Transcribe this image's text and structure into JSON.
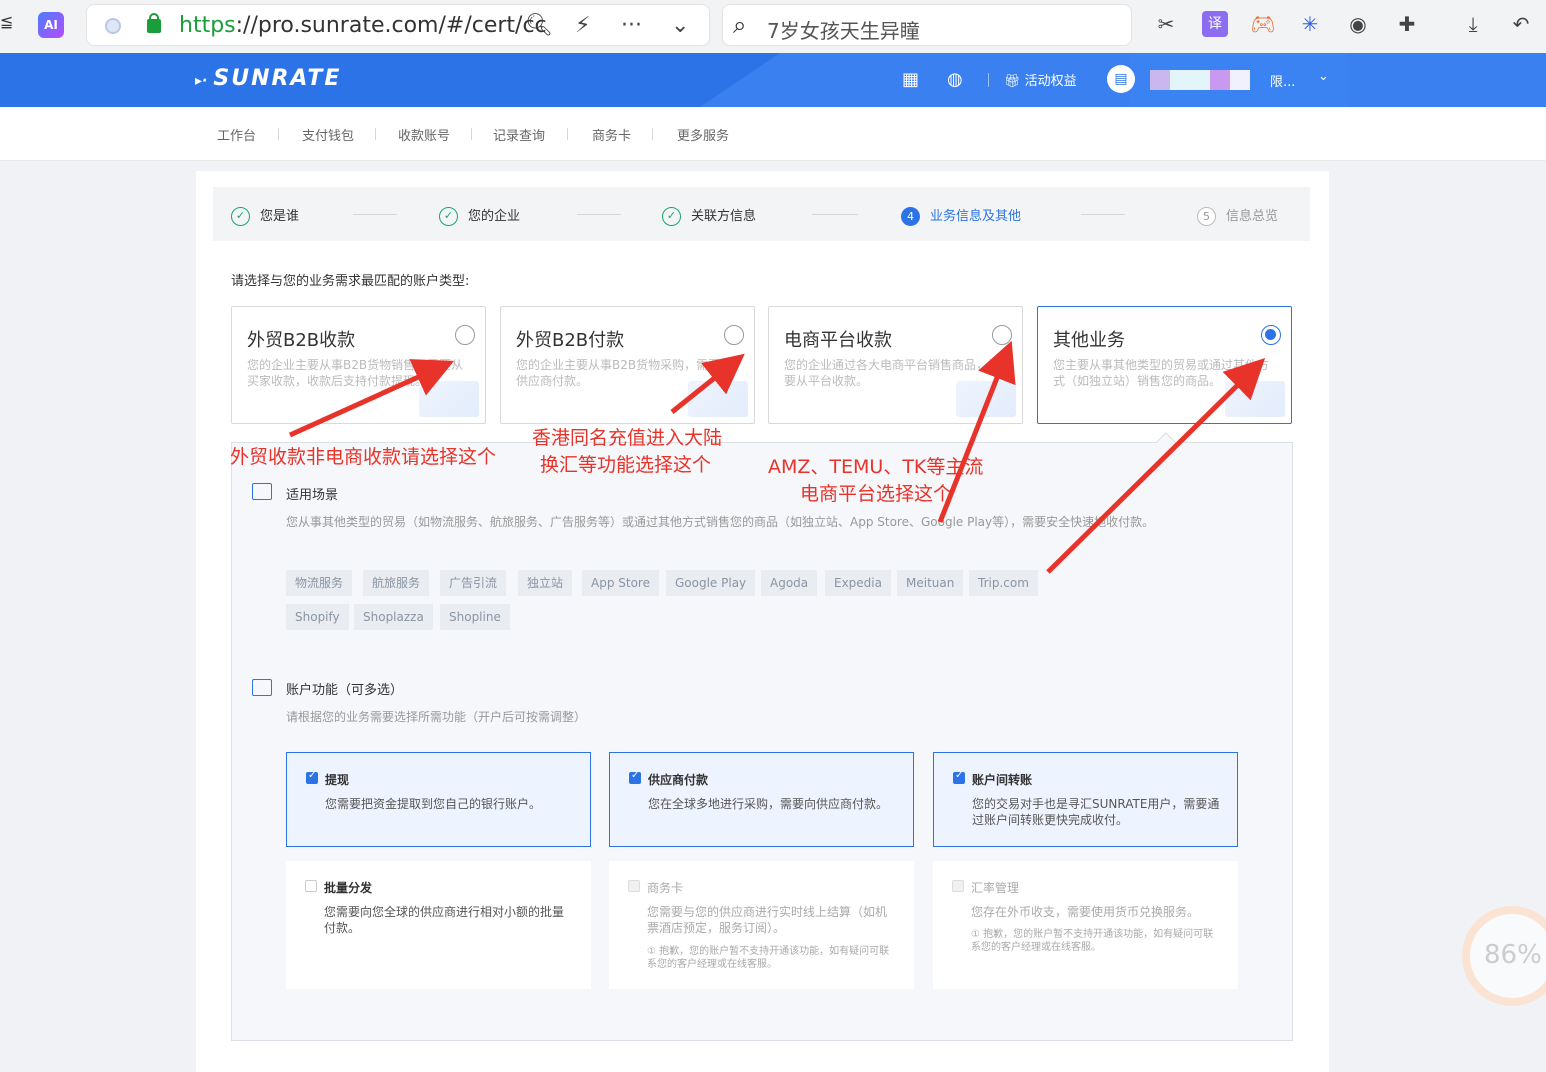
{
  "browser": {
    "left_glyph": "≦",
    "ai_label": "AI",
    "url_green": "https",
    "url_rest": "://pro.sunrate.com/#/cert/cc",
    "search_text": "7岁女孩天生异瞳",
    "ext_translate": "译"
  },
  "header": {
    "logo": "SUNRATE",
    "benefit": "活动权益",
    "user_suffix": "限..."
  },
  "nav": [
    "工作台",
    "支付钱包",
    "收款账号",
    "记录查询",
    "商务卡",
    "更多服务"
  ],
  "steps": [
    {
      "label": "您是谁",
      "num": "✓"
    },
    {
      "label": "您的企业",
      "num": "✓"
    },
    {
      "label": "关联方信息",
      "num": "✓"
    },
    {
      "label": "业务信息及其他",
      "num": "4"
    },
    {
      "label": "信息总览",
      "num": "5"
    }
  ],
  "prompt": "请选择与您的业务需求最匹配的账户类型:",
  "account_types": [
    {
      "title": "外贸B2B收款",
      "desc": "您的企业主要从事B2B货物销售，需要从买家收款，收款后支持付款提现。"
    },
    {
      "title": "外贸B2B付款",
      "desc": "您的企业主要从事B2B货物采购，需要向供应商付款。"
    },
    {
      "title": "电商平台收款",
      "desc": "您的企业通过各大电商平台销售商品，需要从平台收款。"
    },
    {
      "title": "其他业务",
      "desc": "您主要从事其他类型的贸易或通过其他方式（如独立站）销售您的商品。"
    }
  ],
  "scenario": {
    "title": "适用场景",
    "desc": "您从事其他类型的贸易（如物流服务、航旅服务、广告服务等）或通过其他方式销售您的商品（如独立站、App Store、Google Play等），需要安全快速地收付款。",
    "tags": [
      "物流服务",
      "航旅服务",
      "广告引流",
      "独立站",
      "App Store",
      "Google Play",
      "Agoda",
      "Expedia",
      "Meituan",
      "Trip.com",
      "Shopify",
      "Shoplazza",
      "Shopline"
    ]
  },
  "functions": {
    "title": "账户功能（可多选）",
    "desc": "请根据您的业务需要选择所需功能（开户后可按需调整）",
    "items": [
      {
        "title": "提现",
        "desc": "您需要把资金提取到您自己的银行账户。",
        "note": ""
      },
      {
        "title": "供应商付款",
        "desc": "您在全球多地进行采购，需要向供应商付款。",
        "note": ""
      },
      {
        "title": "账户间转账",
        "desc": "您的交易对手也是寻汇SUNRATE用户，需要通过账户间转账更快完成收付。",
        "note": ""
      },
      {
        "title": "批量分发",
        "desc": "您需要向您全球的供应商进行相对小额的批量付款。",
        "note": ""
      },
      {
        "title": "商务卡",
        "desc": "您需要与您的供应商进行实时线上结算（如机票酒店预定，服务订阅）。",
        "note": "① 抱歉，您的账户暂不支持开通该功能，如有疑问可联系您的客户经理或在线客服。"
      },
      {
        "title": "汇率管理",
        "desc": "您存在外币收支，需要使用货币兑换服务。",
        "note": "① 抱歉，您的账户暂不支持开通该功能，如有疑问可联系您的客户经理或在线客服。"
      }
    ]
  },
  "annotations": {
    "a1": "外贸收款非电商收款请选择这个",
    "a2_line1": "香港同名充值进入大陆",
    "a2_line2": "换汇等功能选择这个",
    "a3_line1": "AMZ、TEMU、TK等主流",
    "a3_line2": "电商平台选择这个"
  },
  "zoom_badge": "86%",
  "colors": {
    "brand": "#2d73e8",
    "annotation": "#e8332a",
    "success": "#1aa36b"
  }
}
